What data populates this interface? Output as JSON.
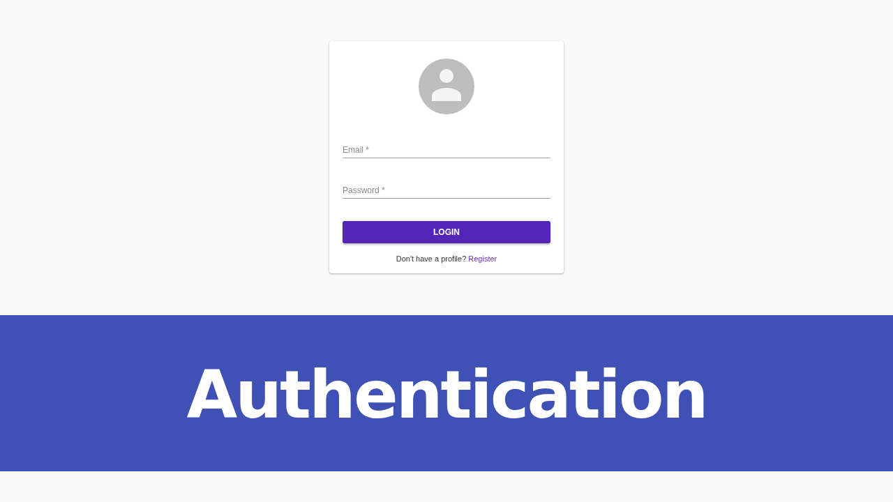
{
  "login_card": {
    "fields": [
      {
        "placeholder": "Email *"
      },
      {
        "placeholder": "Password *"
      }
    ],
    "button": "LOGIN",
    "prompt": {
      "text": "Don't have a profile?",
      "link": "Register"
    }
  },
  "banner": {
    "title": "Authentication"
  }
}
